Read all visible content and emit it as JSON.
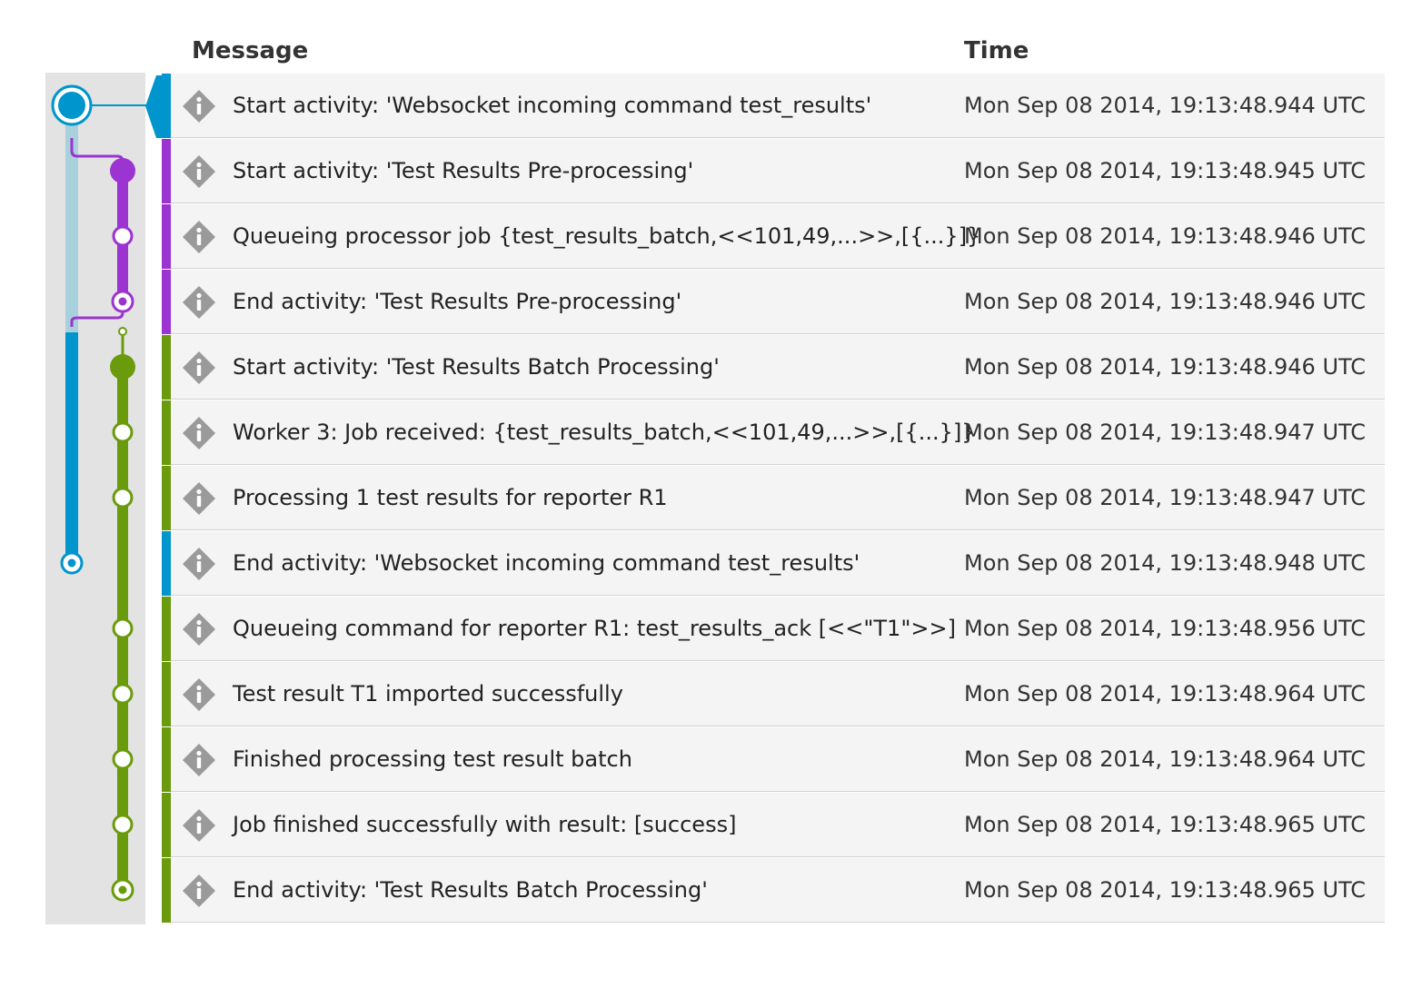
{
  "header": {
    "message": "Message",
    "time": "Time"
  },
  "colors": {
    "blue": "#0095cc",
    "blue_light": "#a9d0dd",
    "purple": "#9b34d0",
    "green": "#6a9b0c",
    "row_bg": "#f4f4f4",
    "panel_bg": "#e3e3e3",
    "icon_gray": "#9a9a9a"
  },
  "rows": [
    {
      "message": "Start activity: 'Websocket incoming command test_results'",
      "time": "Mon Sep 08 2014, 19:13:48.944 UTC",
      "activity": "blue",
      "icon": "info-icon"
    },
    {
      "message": "Start activity: 'Test Results Pre-processing'",
      "time": "Mon Sep 08 2014, 19:13:48.945 UTC",
      "activity": "purple",
      "icon": "info-icon"
    },
    {
      "message": "Queueing processor job {test_results_batch,<<101,49,...>>,[{...}]}",
      "time": "Mon Sep 08 2014, 19:13:48.946 UTC",
      "activity": "purple",
      "icon": "info-icon"
    },
    {
      "message": "End activity: 'Test Results Pre-processing'",
      "time": "Mon Sep 08 2014, 19:13:48.946 UTC",
      "activity": "purple",
      "icon": "info-icon"
    },
    {
      "message": "Start activity: 'Test Results Batch Processing'",
      "time": "Mon Sep 08 2014, 19:13:48.946 UTC",
      "activity": "green",
      "icon": "info-icon"
    },
    {
      "message": "Worker 3: Job received: {test_results_batch,<<101,49,...>>,[{...}]}",
      "time": "Mon Sep 08 2014, 19:13:48.947 UTC",
      "activity": "green",
      "icon": "info-icon"
    },
    {
      "message": "Processing 1 test results for reporter R1",
      "time": "Mon Sep 08 2014, 19:13:48.947 UTC",
      "activity": "green",
      "icon": "info-icon"
    },
    {
      "message": "End activity: 'Websocket incoming command test_results'",
      "time": "Mon Sep 08 2014, 19:13:48.948 UTC",
      "activity": "blue",
      "icon": "info-icon"
    },
    {
      "message": "Queueing command for reporter R1: test_results_ack [<<\"T1\">>]",
      "time": "Mon Sep 08 2014, 19:13:48.956 UTC",
      "activity": "green",
      "icon": "info-icon"
    },
    {
      "message": "Test result T1 imported successfully",
      "time": "Mon Sep 08 2014, 19:13:48.964 UTC",
      "activity": "green",
      "icon": "info-icon"
    },
    {
      "message": "Finished processing test result batch",
      "time": "Mon Sep 08 2014, 19:13:48.964 UTC",
      "activity": "green",
      "icon": "info-icon"
    },
    {
      "message": "Job finished successfully with result: [success]",
      "time": "Mon Sep 08 2014, 19:13:48.965 UTC",
      "activity": "green",
      "icon": "info-icon"
    },
    {
      "message": "End activity: 'Test Results Batch Processing'",
      "time": "Mon Sep 08 2014, 19:13:48.965 UTC",
      "activity": "green",
      "icon": "info-icon"
    }
  ]
}
